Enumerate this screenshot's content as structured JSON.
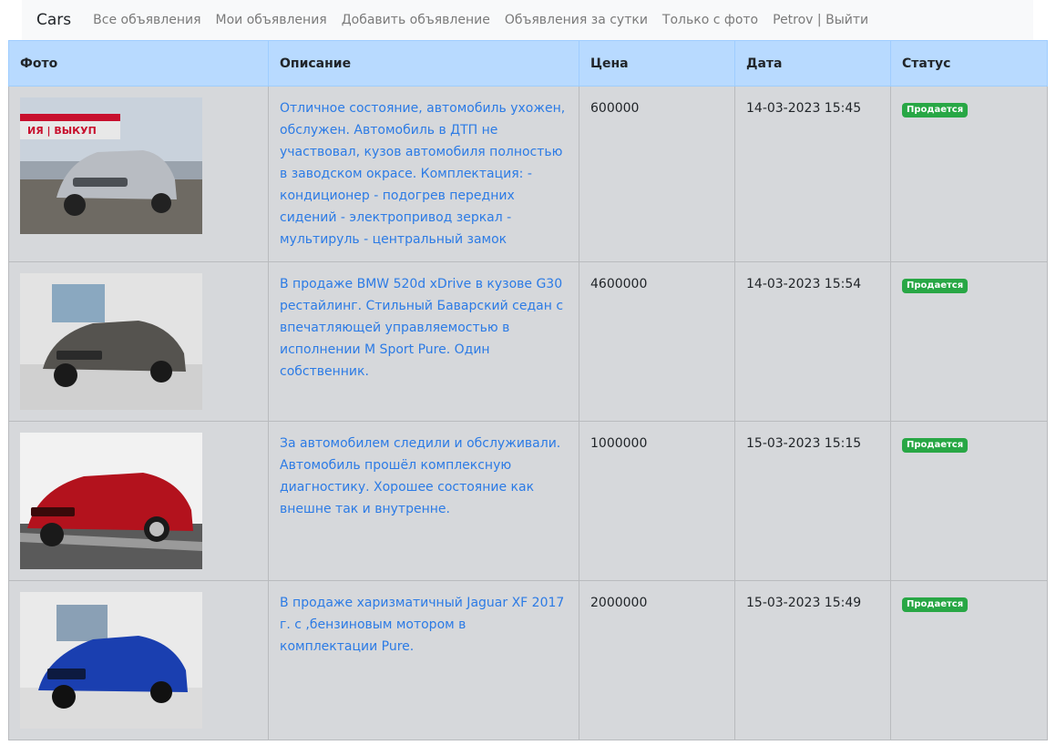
{
  "navbar": {
    "brand": "Cars",
    "links": [
      "Все объявления",
      "Мои объявления",
      "Добавить объявление",
      "Объявления за сутки",
      "Только с фото"
    ],
    "user": "Petrov | Выйти"
  },
  "table": {
    "headers": [
      "Фото",
      "Описание",
      "Цена",
      "Дата",
      "Статус"
    ],
    "rows": [
      {
        "description": "Отличное состояние, автомобиль ухожен, обслужен. Автомобиль в ДТП не участвовал, кузов автомобиля полностью в заводском окрасе. Комплектация: - кондиционер - подогрев передних сидений - электропривод зеркал - мультируль - центральный замок",
        "price": "600000",
        "date": "14-03-2023 15:45",
        "status": "Продается",
        "photo_sign": "ИЯ | ВЫКУП",
        "car_color": "#b8bcc2"
      },
      {
        "description": "В продаже BMW 520d xDrive в кузове G30 рестайлинг. Стильный Баварский седан с впечатляющей управляемостью в исполнении M Sport Pure. Один собственник.",
        "price": "4600000",
        "date": "14-03-2023 15:54",
        "status": "Продается",
        "car_color": "#55534f"
      },
      {
        "description": "За автомобилем следили и обслуживали. Автомобиль прошёл комплексную диагностику. Хорошее состояние как внешне так и внутренне.",
        "price": "1000000",
        "date": "15-03-2023 15:15",
        "status": "Продается",
        "car_color": "#b3121d"
      },
      {
        "description": "В продаже харизматичный Jaguar XF 2017 г. с ,бензиновым мотором в комплектации Pure.",
        "price": "2000000",
        "date": "15-03-2023 15:49",
        "status": "Продается",
        "car_color": "#1a3fb0"
      }
    ]
  },
  "colors": {
    "header_bg": "#b8daff",
    "row_bg": "#d6d8db",
    "link": "#2c7be5",
    "badge": "#28a745"
  }
}
